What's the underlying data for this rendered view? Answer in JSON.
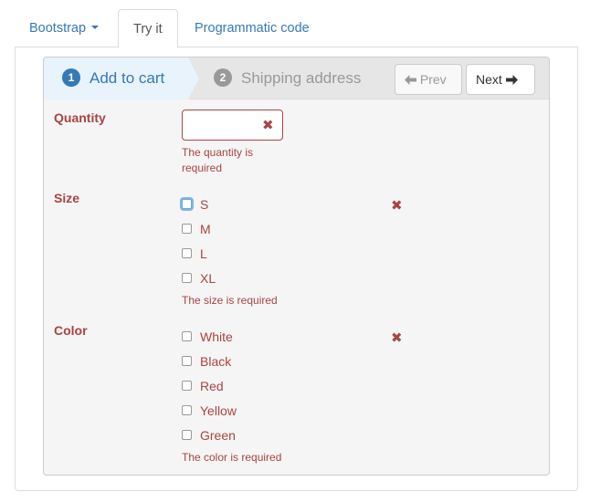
{
  "tabs": [
    {
      "label": "Bootstrap"
    },
    {
      "label": "Try it"
    },
    {
      "label": "Programmatic code"
    }
  ],
  "wizard": {
    "steps": [
      {
        "number": "1",
        "label": "Add to cart"
      },
      {
        "number": "2",
        "label": "Shipping address"
      }
    ],
    "prev_label": "Prev",
    "next_label": "Next"
  },
  "form": {
    "quantity": {
      "label": "Quantity",
      "value": "",
      "error_line1": "The quantity is",
      "error_line2": "required"
    },
    "size": {
      "label": "Size",
      "options": [
        "S",
        "M",
        "L",
        "XL"
      ],
      "error": "The size is required"
    },
    "color": {
      "label": "Color",
      "options": [
        "White",
        "Black",
        "Red",
        "Yellow",
        "Green"
      ],
      "error": "The color is required"
    }
  },
  "colors": {
    "link": "#337ab7",
    "error": "#a94442",
    "active_step_bg": "#e9f3fb"
  }
}
